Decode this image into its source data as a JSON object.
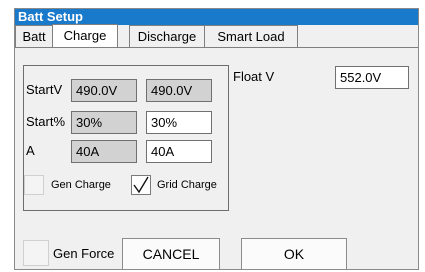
{
  "window": {
    "title": "Batt Setup"
  },
  "tabs": [
    {
      "label": "Batt"
    },
    {
      "label": "Charge"
    },
    {
      "label": "Discharge"
    },
    {
      "label": "Smart Load"
    }
  ],
  "charge": {
    "rows": [
      {
        "label": "StartV",
        "current": "490.0V",
        "value": "490.0V"
      },
      {
        "label": "Start%",
        "current": "30%",
        "value": "30%"
      },
      {
        "label": "A",
        "current": "40A",
        "value": "40A"
      }
    ],
    "gen_charge": {
      "label": "Gen Charge",
      "checked": false
    },
    "grid_charge": {
      "label": "Grid Charge",
      "checked": true
    },
    "float_v": {
      "label": "Float V",
      "value": "552.0V"
    }
  },
  "footer": {
    "gen_force": {
      "label": "Gen Force",
      "checked": false
    },
    "cancel_label": "CANCEL",
    "ok_label": "OK"
  }
}
